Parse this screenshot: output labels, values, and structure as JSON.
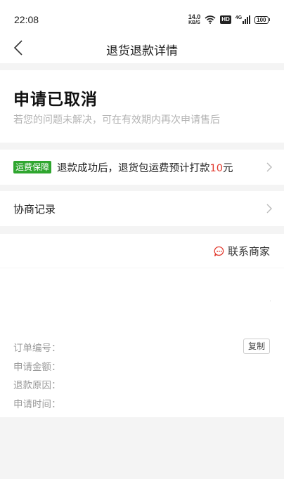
{
  "status_bar": {
    "time": "22:08",
    "net_speed_value": "14.0",
    "net_speed_unit": "KB/S",
    "hd_label": "HD",
    "signal_label": "4G",
    "battery": "100"
  },
  "nav": {
    "title": "退货退款详情"
  },
  "status": {
    "title": "申请已取消",
    "subtitle": "若您的问题未解决，可在有效期内再次申请售后"
  },
  "shipping": {
    "badge": "运费保障",
    "text_before": "退款成功后，退货包运费预计打款",
    "amount": "10",
    "unit": "元"
  },
  "negotiation": {
    "label": "协商记录"
  },
  "contact": {
    "label": "联系商家"
  },
  "order_info": {
    "order_no_label": "订单编号：",
    "copy_label": "复制",
    "amount_label": "申请金额：",
    "reason_label": "退款原因：",
    "time_label": "申请时间："
  }
}
